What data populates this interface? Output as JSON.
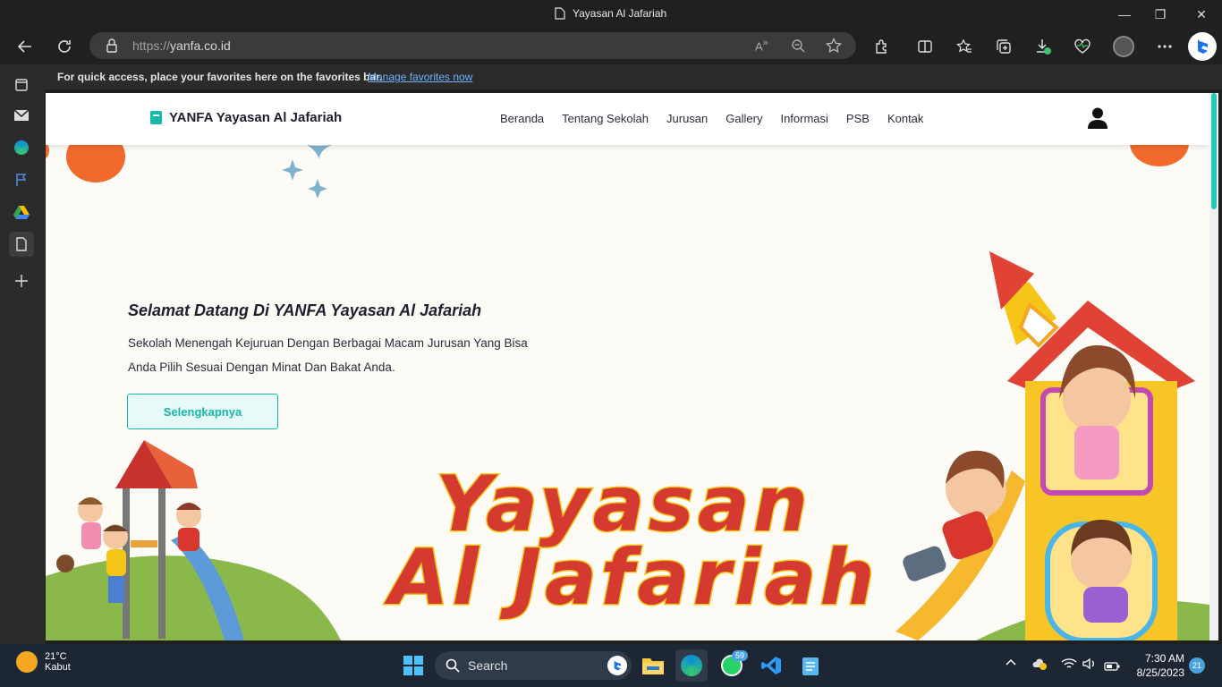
{
  "window": {
    "title": "Yayasan Al Jafariah",
    "minimize": "—",
    "restore": "❐",
    "close": "✕"
  },
  "browser": {
    "url_proto": "https://",
    "url_host": "yanfa.co.id",
    "favorites_message": "For quick access, place your favorites here on the favorites bar.",
    "favorites_link": "Manage favorites now"
  },
  "site": {
    "brand": "YANFA Yayasan Al Jafariah",
    "nav": [
      "Beranda",
      "Tentang Sekolah",
      "Jurusan",
      "Gallery",
      "Informasi",
      "PSB",
      "Kontak"
    ],
    "hero": {
      "title": "Selamat Datang Di YANFA Yayasan Al Jafariah",
      "desc_line1": "Sekolah Menengah Kejuruan Dengan Berbagai Macam Jurusan Yang Bisa",
      "desc_line2": "Anda Pilih Sesuai Dengan Minat Dan Bakat Anda.",
      "button": "Selengkapnya",
      "big_line1": "Yayasan",
      "big_line2": "Al Jafariah"
    }
  },
  "taskbar": {
    "weather_temp": "21°C",
    "weather_desc": "Kabut",
    "search_label": "Search",
    "whatsapp_badge": "59",
    "time": "7:30 AM",
    "date": "8/25/2023",
    "notification_count": "21"
  },
  "colors": {
    "accent": "#16b8a7",
    "title_red": "#d43a2f",
    "title_outline": "#f5c518"
  }
}
